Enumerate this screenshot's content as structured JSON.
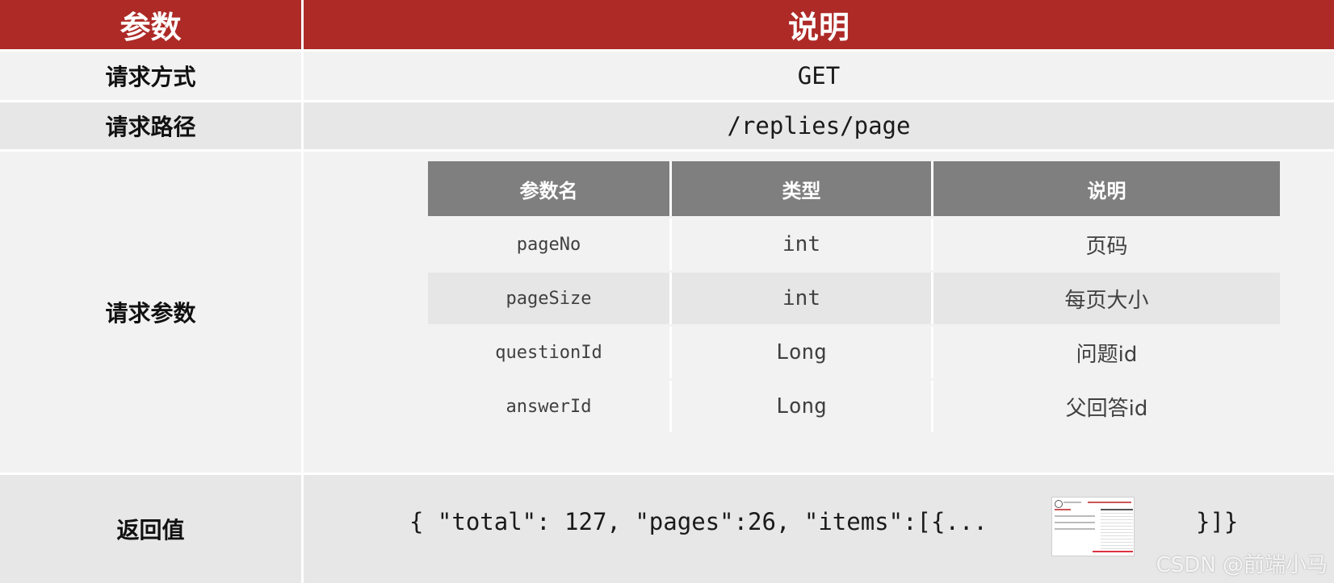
{
  "header": {
    "col1": "参数",
    "col2": "说明"
  },
  "rows": {
    "method": {
      "label": "请求方式",
      "value": "GET"
    },
    "path": {
      "label": "请求路径",
      "value": "/replies/page"
    },
    "params": {
      "label": "请求参数",
      "table": {
        "headers": [
          "参数名",
          "类型",
          "说明"
        ],
        "rows": [
          [
            "pageNo",
            "int",
            "页码"
          ],
          [
            "pageSize",
            "int",
            "每页大小"
          ],
          [
            "questionId",
            "Long",
            "问题id"
          ],
          [
            "answerId",
            "Long",
            "父回答id"
          ]
        ]
      }
    },
    "return": {
      "label": "返回值",
      "value": "{ \"total\": 127, \"pages\":26, \"items\":[{...",
      "value_end": "}]}"
    }
  },
  "watermark": "CSDN @前端小马",
  "colors": {
    "header": "#ad2a27",
    "subheader": "#7f7f7f",
    "row_light": "#f2f2f2",
    "row_mid": "#e7e7e7"
  }
}
